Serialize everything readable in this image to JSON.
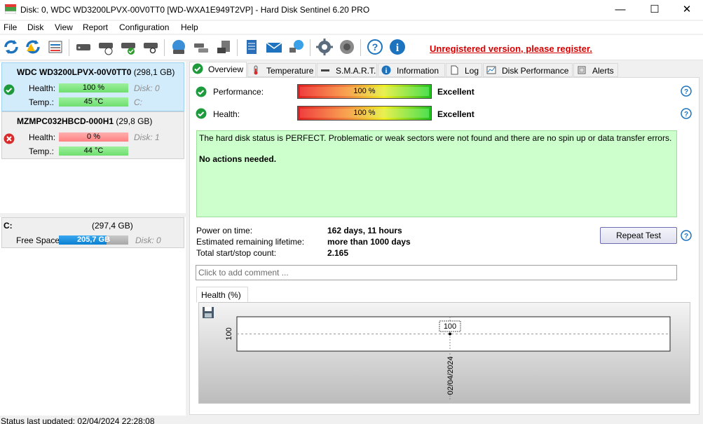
{
  "window": {
    "title": "Disk: 0, WDC WD3200LPVX-00V0TT0 [WD-WXA1E949T2VP]  -  Hard Disk Sentinel 6.20 PRO",
    "minimize": "—",
    "maximize": "☐",
    "close": "✕"
  },
  "menu": {
    "file": "File",
    "disk": "Disk",
    "view": "View",
    "report": "Report",
    "configuration": "Configuration",
    "help": "Help"
  },
  "toolbar": {
    "register_notice": "Unregistered version, please register."
  },
  "disks": [
    {
      "name": "WDC WD3200LPVX-00V0TT0",
      "size": "(298,1 GB)",
      "health_label": "Health:",
      "health_value": "100 %",
      "health_percent": 100,
      "temp_label": "Temp.:",
      "temp_value": "45 °C",
      "disk_index": "Disk: 0",
      "drive_letter": "C:",
      "status": "ok"
    },
    {
      "name": "MZMPC032HBCD-000H1",
      "size": "(29,8 GB)",
      "health_label": "Health:",
      "health_value": "0 %",
      "health_percent": 0,
      "temp_label": "Temp.:",
      "temp_value": "44 °C",
      "disk_index": "Disk: 1",
      "status": "error"
    }
  ],
  "volume": {
    "letter": "C:",
    "size": "(297,4 GB)",
    "free_label": "Free Space",
    "free_value": "205,7 GB",
    "free_fraction": 0.69,
    "disk_index": "Disk: 0"
  },
  "tabs": [
    {
      "label": "Overview",
      "icon": "check-icon"
    },
    {
      "label": "Temperature",
      "icon": "thermometer-icon"
    },
    {
      "label": "S.M.A.R.T.",
      "icon": "smart-icon"
    },
    {
      "label": "Information",
      "icon": "info-icon"
    },
    {
      "label": "Log",
      "icon": "log-icon"
    },
    {
      "label": "Disk Performance",
      "icon": "performance-icon"
    },
    {
      "label": "Alerts",
      "icon": "alerts-icon"
    }
  ],
  "overview": {
    "performance_label": "Performance:",
    "performance_value": "100 %",
    "performance_percent": 100,
    "performance_rating": "Excellent",
    "health_label": "Health:",
    "health_value": "100 %",
    "health_percent": 100,
    "health_rating": "Excellent",
    "status_text": "The hard disk status is PERFECT. Problematic or weak sectors were not found and there are no spin up or data transfer errors.",
    "status_action": "No actions needed.",
    "power_on_label": "Power on time:",
    "power_on_value": "162 days, 11 hours",
    "lifetime_label": "Estimated remaining lifetime:",
    "lifetime_value": "more than 1000 days",
    "startstop_label": "Total start/stop count:",
    "startstop_value": "2.165",
    "repeat_test": "Repeat Test",
    "comment_placeholder": "Click to add comment ..."
  },
  "health_chart_tab": "Health (%)",
  "chart_data": {
    "type": "line",
    "x": [
      "02/04/2024"
    ],
    "series": [
      {
        "values": [
          100
        ]
      }
    ],
    "ylabel": "",
    "y_tick": "100",
    "point_label": "100",
    "x_tick": "02/04/2024",
    "grid": true
  },
  "statusbar": {
    "text": "Status last updated: 02/04/2024 22:28:08"
  }
}
